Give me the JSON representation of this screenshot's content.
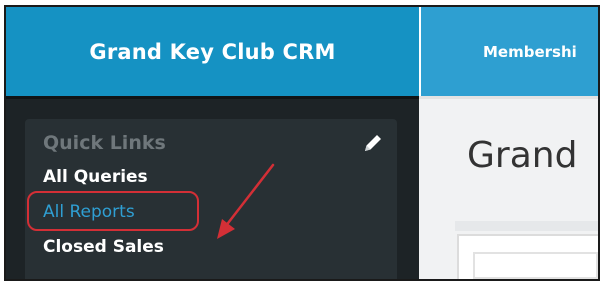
{
  "header": {
    "app_title": "Grand Key Club CRM",
    "nav_items": [
      {
        "label": "Membershi"
      }
    ],
    "brand_color": "#1592c3"
  },
  "sidebar": {
    "panel_title": "Quick Links",
    "edit_icon": "pencil-icon",
    "links": [
      {
        "label": "All Queries"
      },
      {
        "label": "All Reports",
        "highlighted": true
      },
      {
        "label": "Closed Sales"
      }
    ],
    "annotation_color": "#d32f36"
  },
  "main": {
    "page_title": "Grand"
  }
}
